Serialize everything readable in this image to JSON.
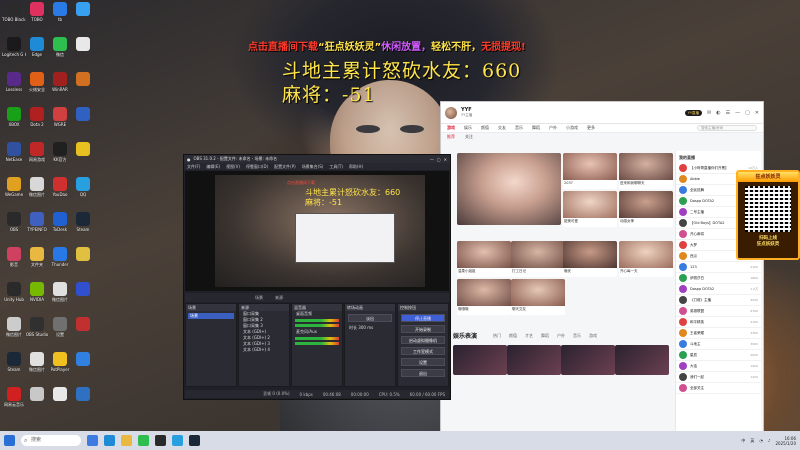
{
  "overlay": {
    "banner_part1": "点击直播间下载",
    "banner_part2": "“狂点妖妖灵”",
    "banner_part3": "休闲放置，",
    "banner_part4": "轻松不肝，",
    "banner_part5": "无损提现!",
    "score_line1": "斗地主累计怒砍水友：660",
    "score_line2": "麻将：-51"
  },
  "desktop_icons": [
    {
      "label": "TOBO Black Badger",
      "color": "#2b2b2b"
    },
    {
      "label": "TOBO",
      "color": "#e03060"
    },
    {
      "label": "tb",
      "color": "#2a7be6"
    },
    {
      "label": "",
      "color": "#38a0f0"
    },
    {
      "label": "Logitech G HUB",
      "color": "#1a1a1a"
    },
    {
      "label": "Edge",
      "color": "#1f8bd6"
    },
    {
      "label": "微信",
      "color": "#2ebd4f"
    },
    {
      "label": "",
      "color": "#e8e8e8"
    },
    {
      "label": "Lossless",
      "color": "#5a2a8a"
    },
    {
      "label": "火绒安全",
      "color": "#e06018"
    },
    {
      "label": "WinRAR",
      "color": "#a02020"
    },
    {
      "label": "",
      "color": "#d07020"
    },
    {
      "label": "XBOX",
      "color": "#18a018"
    },
    {
      "label": "Dota 2",
      "color": "#b02020"
    },
    {
      "label": "WGRE",
      "color": "#d04040"
    },
    {
      "label": "",
      "color": "#3060c0"
    },
    {
      "label": "NetEase",
      "color": "#3050a0"
    },
    {
      "label": "网易游戏",
      "color": "#c02828"
    },
    {
      "label": "KK官方",
      "color": "#202020"
    },
    {
      "label": "",
      "color": "#e8c020"
    },
    {
      "label": "WeGame",
      "color": "#e0a020"
    },
    {
      "label": "微信图片",
      "color": "#d8d8d8"
    },
    {
      "label": "YouDao",
      "color": "#d03030"
    },
    {
      "label": "QQ",
      "color": "#28a0e0"
    },
    {
      "label": "OBS",
      "color": "#2a2a2a"
    },
    {
      "label": "TYPEINFO",
      "color": "#4060c0"
    },
    {
      "label": "ToDesk",
      "color": "#2060d0"
    },
    {
      "label": "Steam",
      "color": "#1b2838"
    },
    {
      "label": "影音",
      "color": "#d04060"
    },
    {
      "label": "文件夹",
      "color": "#e8b840"
    },
    {
      "label": "Thunder",
      "color": "#2878e8"
    },
    {
      "label": "",
      "color": "#e0c040"
    },
    {
      "label": "Unity Hub",
      "color": "#2a2a2a"
    },
    {
      "label": "NVIDIA",
      "color": "#76b900"
    },
    {
      "label": "微信图片",
      "color": "#e0e0e0"
    },
    {
      "label": "",
      "color": "#3050d0"
    },
    {
      "label": "微信图片",
      "color": "#cccccc"
    },
    {
      "label": "OBS Studio",
      "color": "#303030"
    },
    {
      "label": "设置",
      "color": "#707070"
    },
    {
      "label": "",
      "color": "#c03030"
    },
    {
      "label": "Steam",
      "color": "#1b2838"
    },
    {
      "label": "微信图片",
      "color": "#e0e0e0"
    },
    {
      "label": "PotPlayer",
      "color": "#f0c020"
    },
    {
      "label": "",
      "color": "#3080e0"
    },
    {
      "label": "网易云音乐",
      "color": "#d02020"
    },
    {
      "label": "",
      "color": "#c8c8c8"
    },
    {
      "label": "",
      "color": "#e8e8e8"
    },
    {
      "label": "",
      "color": "#3070c0"
    }
  ],
  "obs": {
    "title": "OBS 31.0.2 - 配置文件: 未命名 - 场景: 未命名",
    "menu": [
      "文件(F)",
      "编辑(E)",
      "视图(V)",
      "停靠窗口(D)",
      "配置文件(P)",
      "场景集合(S)",
      "工具(T)",
      "帮助(H)"
    ],
    "tabs": [
      "场景",
      "来源"
    ],
    "docks": {
      "scenes": {
        "header": "场景",
        "items": [
          "场景"
        ]
      },
      "sources": {
        "header": "来源",
        "items": [
          "窗口采集",
          "窗口采集 2",
          "窗口采集 3",
          "文本 (GDI+)",
          "文本 (GDI+) 2",
          "文本 (GDI+) 3",
          "文本 (GDI+) 4"
        ]
      },
      "mixer": {
        "header": "混音器",
        "items": [
          "桌面音频",
          "麦克风/Aux"
        ]
      },
      "transitions": {
        "header": "转场动画",
        "fade": "淡出",
        "duration_label": "时长",
        "duration": "300 ms"
      },
      "controls": {
        "header": "控制按钮",
        "buttons": [
          "停止直播",
          "开始录制",
          "启动虚拟摄像机",
          "工作室模式",
          "设置",
          "退出"
        ]
      }
    },
    "status": [
      "丢帧 0 (0.0%)",
      "0 kbps",
      "00:46:08",
      "00:00:00",
      "CPU: 0.5%",
      "60.00 / 60.00 FPS"
    ]
  },
  "yy": {
    "user_name": "YYF",
    "user_sub": "YY主播",
    "pill": "YY直播",
    "nav": [
      "游戏",
      "娱乐",
      "颜值",
      "交友",
      "音乐",
      "舞蹈",
      "户外",
      "小游戏",
      "更多"
    ],
    "nav_active": 0,
    "search_placeholder": "搜索主播/房间",
    "sub_nav": [
      "推荐",
      "关注"
    ],
    "thumbs": [
      {
        "cap": "2037"
      },
      {
        "cap": "进来和我聊聊天"
      },
      {
        "cap": "甜美可爱"
      },
      {
        "cap": "动感女神"
      },
      {
        "cap": "温柔小姐姐"
      },
      {
        "cap": "打工日记"
      },
      {
        "cap": "晚安"
      },
      {
        "cap": "开心每一天"
      },
      {
        "cap": "哦哦哦"
      },
      {
        "cap": "聊天交友"
      }
    ],
    "section_title": "娱乐表演",
    "section_tabs": [
      "热门",
      "颜值",
      "才艺",
      "舞蹈",
      "户外",
      "音乐",
      "游戏"
    ],
    "side_header": "我的直播",
    "side_rows": [
      {
        "name": "【小阿哥直播你们开黑】",
        "stat": "12万人"
      },
      {
        "name": "Abbie",
        "stat": "2万人"
      },
      {
        "name": "全民炫舞",
        "stat": "9882"
      },
      {
        "name": "Dospp DOTA2",
        "stat": "1.5万"
      },
      {
        "name": "二号主播",
        "stat": "8300"
      },
      {
        "name": "【Old Boys】DOTA2",
        "stat": "2.1万"
      },
      {
        "name": "开心麻将",
        "stat": "5500"
      },
      {
        "name": "大罗",
        "stat": "4100"
      },
      {
        "name": "西瓜",
        "stat": "3300"
      },
      {
        "name": "123",
        "stat": "2100"
      },
      {
        "name": "伊丽莎白",
        "stat": "1800"
      },
      {
        "name": "Dospp DOTA2",
        "stat": "1.2万"
      },
      {
        "name": "《刀塔》主播",
        "stat": "9500"
      },
      {
        "name": "英雄联盟",
        "stat": "6700"
      },
      {
        "name": "和平精英",
        "stat": "5100"
      },
      {
        "name": "王者荣耀",
        "stat": "4300"
      },
      {
        "name": "斗地主",
        "stat": "3900"
      },
      {
        "name": "星辰",
        "stat": "2600"
      },
      {
        "name": "大话",
        "stat": "1900"
      },
      {
        "name": "我们一起",
        "stat": "1200"
      },
      {
        "name": "全部关注",
        "stat": ""
      }
    ]
  },
  "qr": {
    "header": "狂点妖妖灵",
    "footer1": "扫码上线",
    "footer2": "狂点妖妖灵"
  },
  "taskbar": {
    "search_placeholder": "搜索",
    "tray": [
      "中",
      "英"
    ],
    "time": "16:06",
    "date": "2025/1/20"
  }
}
